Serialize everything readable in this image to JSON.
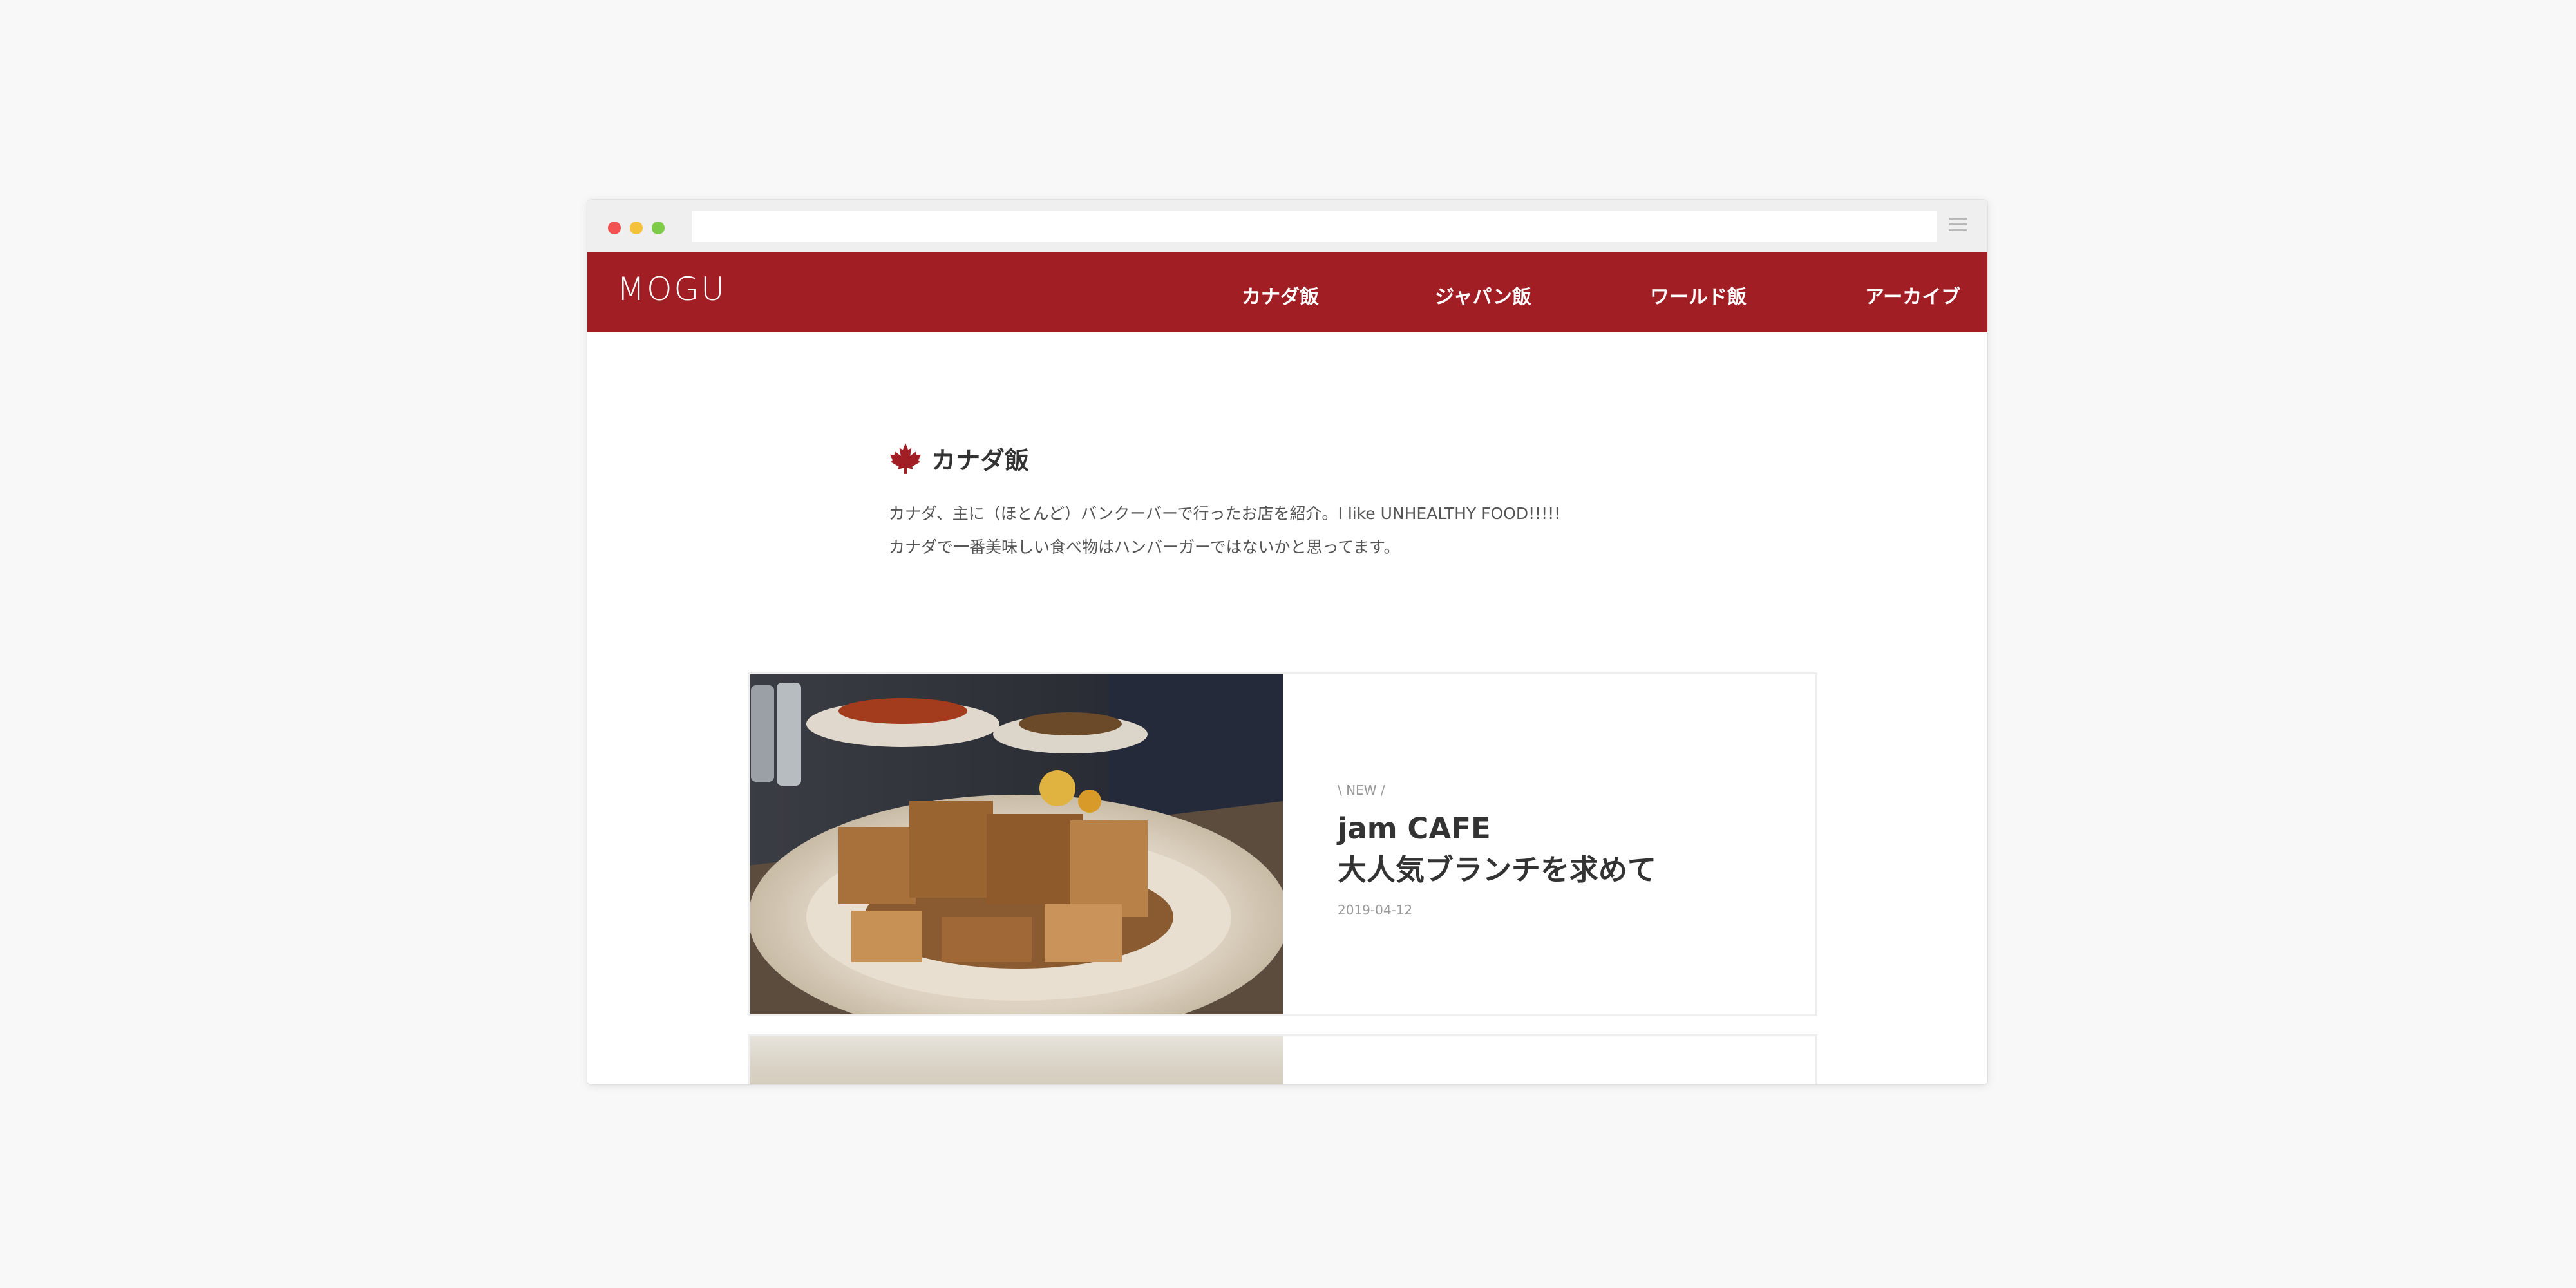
{
  "site": {
    "logo": "MOGU",
    "brand_color": "#a21e25",
    "nav": [
      {
        "label": "カナダ飯"
      },
      {
        "label": "ジャパン飯"
      },
      {
        "label": "ワールド飯"
      },
      {
        "label": "アーカイブ"
      }
    ]
  },
  "section": {
    "icon": "maple-leaf-icon",
    "title": "カナダ飯",
    "description_lines": [
      "カナダ、主に（ほとんど）バンクーバーで行ったお店を紹介。I like UNHEALTHY FOOD!!!!!",
      "カナダで一番美味しい食べ物はハンバーガーではないかと思ってます。"
    ]
  },
  "posts": [
    {
      "badge": "\\ NEW /",
      "title_lines": [
        "jam CAFE",
        "大人気ブランチを求めて"
      ],
      "date": "2019-04-12",
      "image": "french-toast-plate-photo"
    },
    {
      "image": "food-photo"
    }
  ]
}
